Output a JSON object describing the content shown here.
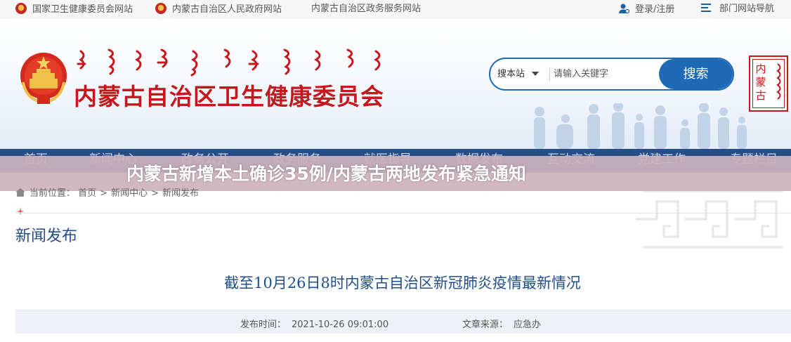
{
  "topbar": {
    "links": [
      {
        "label": "国家卫生健康委员会网站"
      },
      {
        "label": "内蒙古自治区人民政府网站"
      },
      {
        "label": "内蒙古自治区政务服务网站"
      }
    ],
    "login": "登录/注册",
    "department_nav": "部门网站导航"
  },
  "header": {
    "site_title": "内蒙古自治区卫生健康委员会",
    "mongolian_script": "ᠥᠪᠦᠷ ᠮᠣᠩᠭᠣᠯ ᠤᠨ",
    "search": {
      "scope": "搜本站",
      "placeholder": "请输入关键字",
      "button": "搜索"
    },
    "seal_text": "内蒙古"
  },
  "nav": {
    "items": [
      {
        "label": "首页"
      },
      {
        "label": "新闻中心"
      },
      {
        "label": "政务公开"
      },
      {
        "label": "政务服务"
      },
      {
        "label": "就医指导"
      },
      {
        "label": "数据发布"
      },
      {
        "label": "互动交流"
      },
      {
        "label": "党建工作"
      },
      {
        "label": "专题栏目"
      }
    ]
  },
  "overlay": {
    "headline": "内蒙古新增本土确诊35例/内蒙古两地发布紧急通知"
  },
  "breadcrumb": {
    "prefix": "当前位置：",
    "items": [
      {
        "label": "首页"
      },
      {
        "label": "新闻中心"
      },
      {
        "label": "新闻发布"
      }
    ],
    "separator": ">"
  },
  "section": {
    "plus": "+",
    "title": "新闻发布"
  },
  "article": {
    "title": "截至10月26日8时内蒙古自治区新冠肺炎疫情最新情况",
    "publish_label": "发布时间：",
    "publish_time": "2021-10-26 09:01:00",
    "source_label": "文章来源：",
    "source": "应急办"
  },
  "colors": {
    "brand_red": "#c8161d",
    "brand_blue": "#1e6ab7",
    "nav_blue": "#274d87"
  }
}
